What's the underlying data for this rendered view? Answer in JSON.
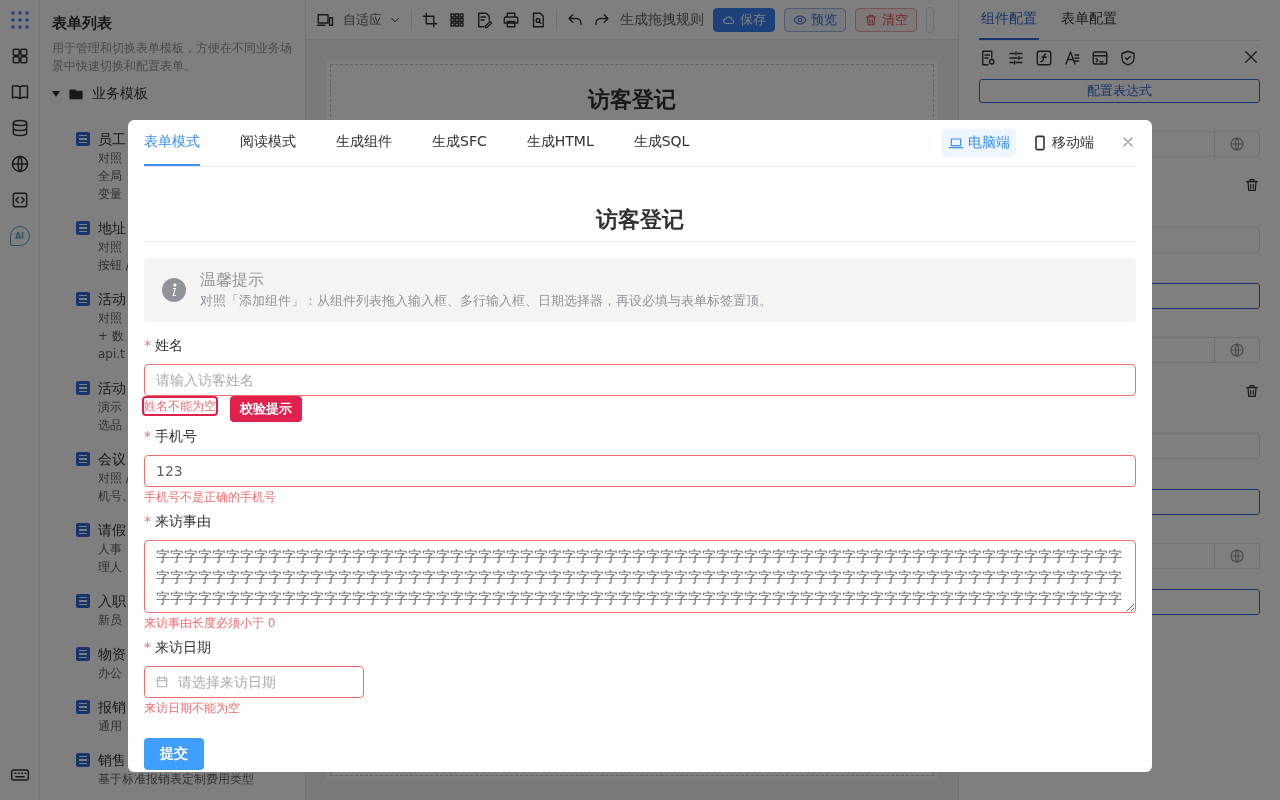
{
  "rail": {
    "ai_badge": "AI"
  },
  "sidebar": {
    "title": "表单列表",
    "description": "用于管理和切换表单模板，方便在不同业务场景中快速切换和配置表单。",
    "group": {
      "label": "业务模板",
      "expanded": true,
      "children": [
        {
          "title": "员工",
          "lines": [
            "对照",
            "全局",
            "变量"
          ]
        },
        {
          "title": "地址",
          "lines": [
            "对照",
            "按钮 /"
          ]
        },
        {
          "title": "活动",
          "lines": [
            "对照",
            "+ 数",
            "api.t"
          ]
        },
        {
          "title": "活动",
          "lines": [
            "演示",
            "选品"
          ]
        },
        {
          "title": "会议",
          "lines": [
            "对照 /",
            "机号、"
          ]
        },
        {
          "title": "请假",
          "lines": [
            "人事",
            "理人"
          ]
        },
        {
          "title": "入职",
          "lines": [
            "新员"
          ]
        },
        {
          "title": "物资",
          "lines": [
            "办公"
          ]
        },
        {
          "title": "报销",
          "lines": [
            "通用"
          ]
        },
        {
          "title": "销售",
          "lines": [
            "基于标准报销表定制费用类型"
          ]
        }
      ]
    }
  },
  "toolbar": {
    "device_select": "自适应",
    "rule_label": "生成拖拽规则",
    "buttons": [
      {
        "label": "保存",
        "kind": "primary"
      },
      {
        "label": "预览",
        "kind": "plain"
      },
      {
        "label": "清空",
        "kind": "danger"
      }
    ]
  },
  "canvas": {
    "title": "访客登记"
  },
  "right_panel": {
    "tabs": [
      {
        "label": "组件配置",
        "selected": true
      },
      {
        "label": "表单配置",
        "selected": false
      }
    ],
    "expression_button": "配置表达式"
  },
  "modal": {
    "tabs": [
      {
        "label": "表单模式",
        "selected": true
      },
      {
        "label": "阅读模式",
        "selected": false
      },
      {
        "label": "生成组件",
        "selected": false
      },
      {
        "label": "生成SFC",
        "selected": false
      },
      {
        "label": "生成HTML",
        "selected": false
      },
      {
        "label": "生成SQL",
        "selected": false
      }
    ],
    "devices": [
      {
        "label": "电脑端",
        "kind": "desktop",
        "selected": true
      },
      {
        "label": "移动端",
        "kind": "mobile",
        "selected": false
      }
    ],
    "form_title": "访客登记",
    "notice": {
      "title": "温馨提示",
      "text": "对照「添加组件」：从组件列表拖入输入框、多行输入框、日期选择器，再设必填与表单标签置顶。"
    },
    "fields": [
      {
        "kind": "input",
        "required_mark": "*",
        "label": "姓名",
        "placeholder": "请输入访客姓名",
        "error": "姓名不能为空",
        "highlighted": true
      },
      {
        "kind": "input",
        "required_mark": "*",
        "label": "手机号",
        "value": "123",
        "error": "手机号不是正确的手机号",
        "highlighted": false
      },
      {
        "kind": "textarea",
        "required_mark": "*",
        "label": "来访事由",
        "value": "字字字字字字字字字字字字字字字字字字字字字字字字字字字字字字字字字字字字字字字字字字字字字字字字字字字字字字字字字字字字字字字字字字字字字字字字字字字字字字字字字字字字字字字字字字字字字字字字字字字字字字字字字字字字字字字字字字字字字字字字字字字字字字字字字字字字字字字字字字字字字字字字字字字字字字字字字字字字字字字字字字字字字字字字字字字字字字字字字字字字字字字字字字字字字字字字字字字字字字字字字字字字字字字字字字字字字字字字字字",
        "error": "来访事由长度必须小于 0",
        "highlighted": false
      },
      {
        "kind": "date",
        "required_mark": "*",
        "label": "来访日期",
        "placeholder": "请选择来访日期",
        "error": "来访日期不能为空",
        "highlighted": false
      }
    ],
    "submit": "提交"
  },
  "annotation": {
    "label": "校验提示"
  }
}
